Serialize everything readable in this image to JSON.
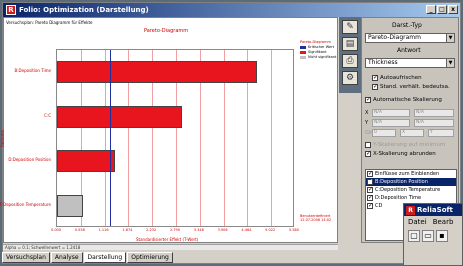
{
  "window": {
    "title": "Folio: Optimization (Darstellung)",
    "icon_letter": "R",
    "btn_min": "_",
    "btn_max": "□",
    "btn_close": "x"
  },
  "chart_head": "Versuchsplan: Pareto Diagramm für Effekte",
  "chart_data": {
    "type": "bar",
    "title": "Pareto-Diagramm",
    "xlabel": "Standardisierter Effekt (T-Wert)",
    "ylabel": "Faktoren",
    "categories": [
      "B:Deposition Time",
      "C:C",
      "D:Deposition Position",
      "F:Deposition Temperature"
    ],
    "values": [
      4.68,
      2.93,
      1.35,
      0.62
    ],
    "colors": [
      "#e8141e",
      "#e8141e",
      "#e8141e",
      "#c0c0c0"
    ],
    "critical_value": 1.24,
    "xlim": [
      0,
      5.58
    ],
    "xticks": [
      "0.000",
      "0.558",
      "1.116",
      "1.674",
      "2.232",
      "2.790",
      "3.348",
      "3.906",
      "4.464",
      "5.022",
      "5.580"
    ]
  },
  "legend": {
    "title": "Pareto-Diagramm",
    "items": [
      {
        "label": "Kritischer Wert",
        "color": "#2030a0"
      },
      {
        "label": "Signifikant",
        "color": "#e8141e"
      },
      {
        "label": "Nicht signifikant",
        "color": "#c0c0c0"
      }
    ]
  },
  "annotation": "Benutzerdefiniert 12.07.2006 14:02",
  "status": "Alpha = 0.1; Schwellenwert = 1.2418",
  "tabs": [
    "Versuchsplan",
    "Analyse",
    "Darstellung",
    "Optimierung"
  ],
  "panel": {
    "section1": "Darst.-Typ",
    "plot_type": "Pareto-Diagramm",
    "section2": "Antwort",
    "response": "Thickness",
    "auto_refresh": "Autoaufrischen",
    "std_effects": "Stand. verhält. bedeutsa.",
    "auto_scale": "Automatische Skalierung",
    "x_label": "X",
    "y_label": "Y",
    "n_a": "N/A",
    "grid_label": "Gitternetz",
    "grid_vals": [
      "0",
      "X",
      "Y"
    ],
    "fix_scale": "Y-Skalierung auf minimum",
    "round_x": "X-Skalierung abrunden",
    "effects_label": "Einflüsse zum Einblenden",
    "effects": [
      {
        "label": "B:Deposition Position",
        "checked": true,
        "selected": true
      },
      {
        "label": "C:Deposition Temperature",
        "checked": true,
        "selected": false
      },
      {
        "label": "D:Deposition Time",
        "checked": true,
        "selected": false
      },
      {
        "label": "CD",
        "checked": true,
        "selected": false
      }
    ]
  },
  "reliasoft": {
    "title": "ReliaSoft",
    "logo": "R",
    "menu": [
      "Datei",
      "Bearb"
    ]
  }
}
